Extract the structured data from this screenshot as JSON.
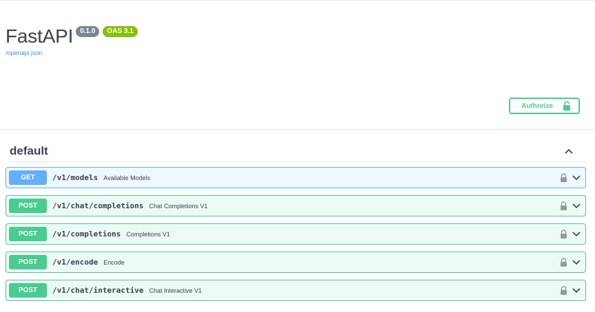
{
  "info": {
    "title": "FastAPI",
    "version": "0.1.0",
    "oas_version": "OAS 3.1",
    "spec_link": "/openapi.json"
  },
  "authorize": {
    "label": "Authorize",
    "icon": "lock-open-icon",
    "color": "#49cc90"
  },
  "tag": {
    "name": "default",
    "toggle_icon": "chevron-up-icon"
  },
  "operations": [
    {
      "method": "GET",
      "path": "/v1/models",
      "summary": "Available Models"
    },
    {
      "method": "POST",
      "path": "/v1/chat/completions",
      "summary": "Chat Completions V1"
    },
    {
      "method": "POST",
      "path": "/v1/completions",
      "summary": "Completions V1"
    },
    {
      "method": "POST",
      "path": "/v1/encode",
      "summary": "Encode"
    },
    {
      "method": "POST",
      "path": "/v1/chat/interactive",
      "summary": "Chat Interactive V1"
    }
  ],
  "colors": {
    "get": "#61affe",
    "post": "#49cc90",
    "text": "#3b4151",
    "link": "#4990e2",
    "version_badge": "#7d8492",
    "oas_badge": "#89bf04"
  }
}
